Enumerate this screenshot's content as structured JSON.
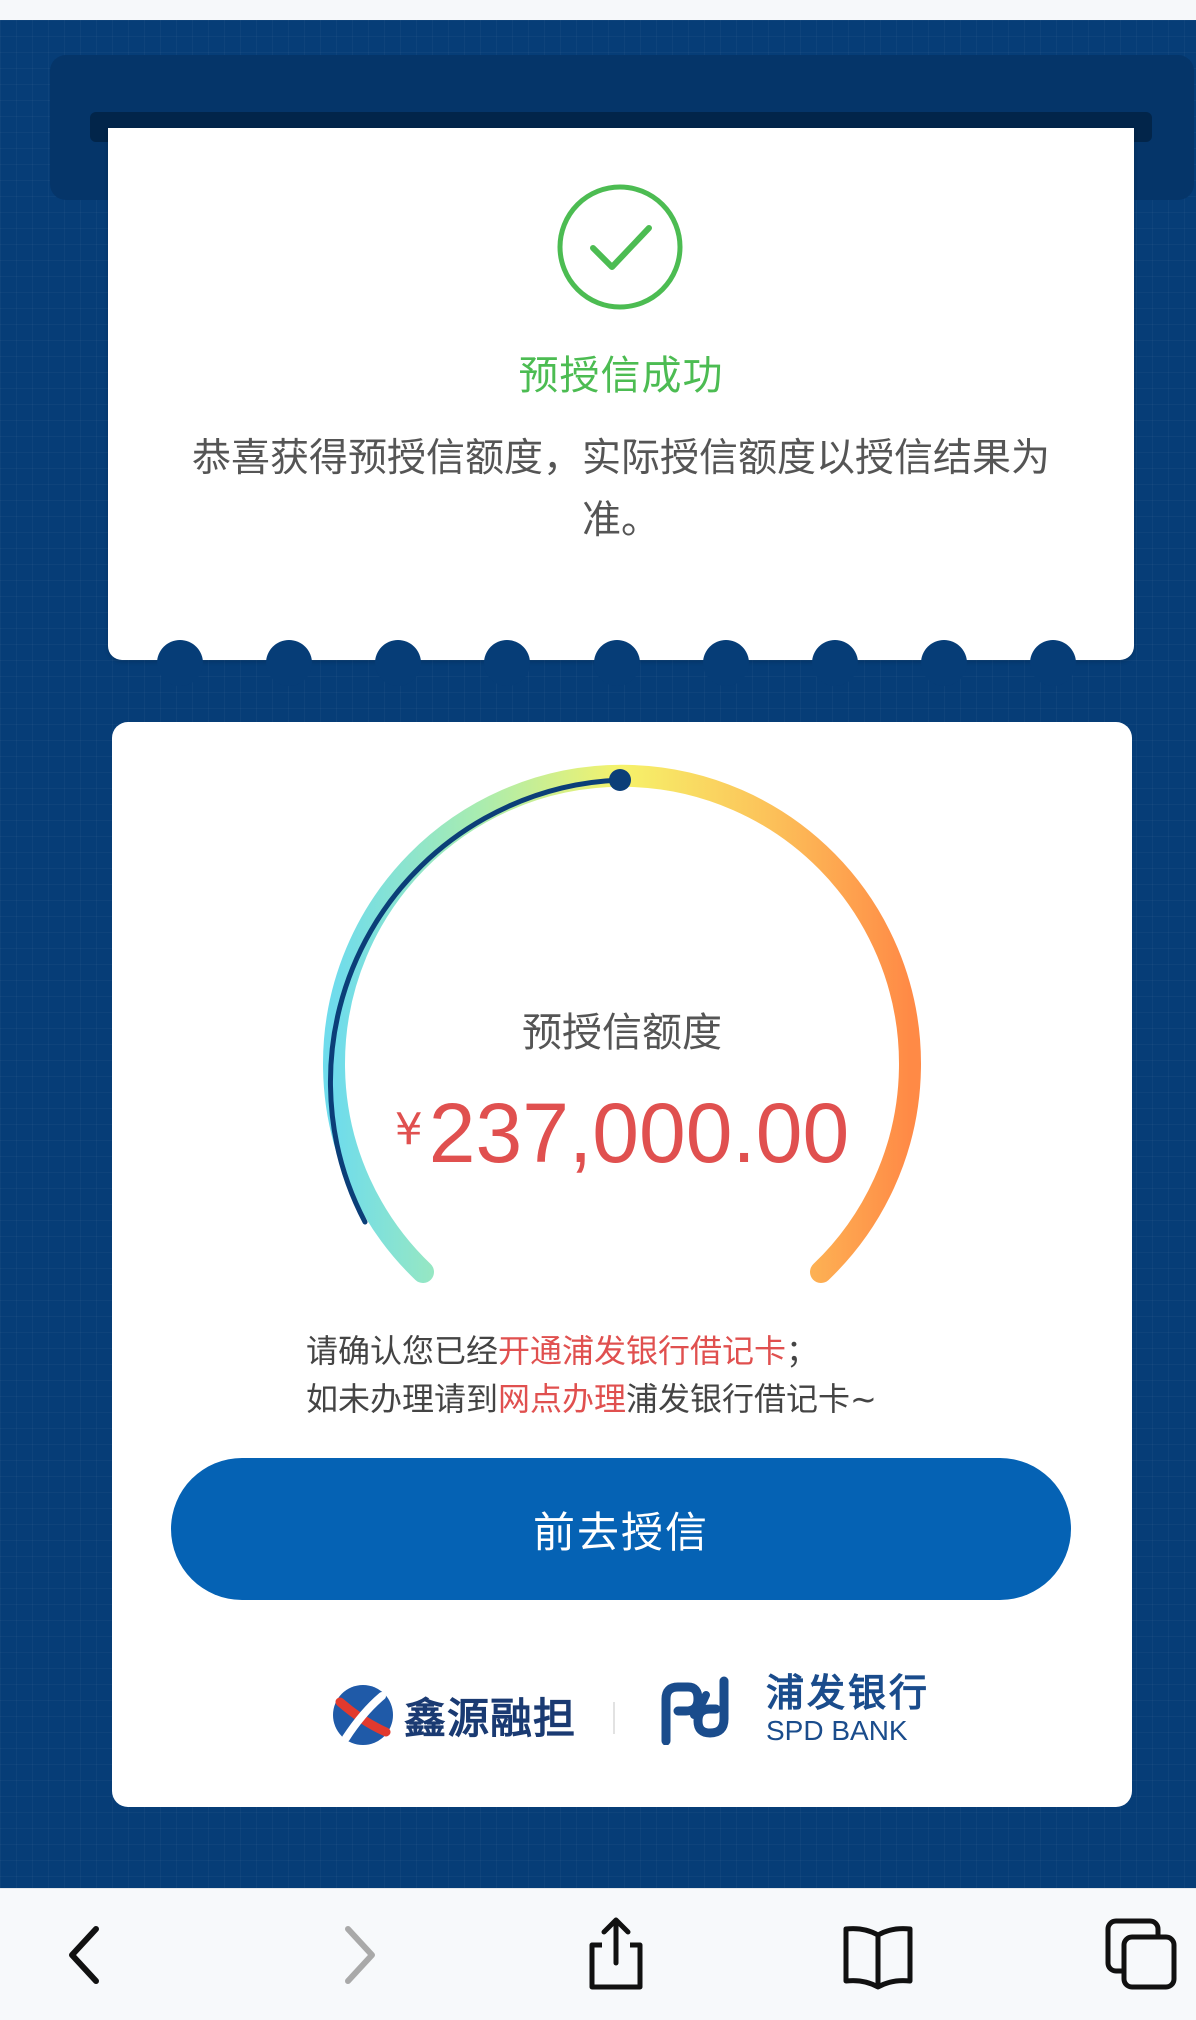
{
  "ticket": {
    "title": "预授信成功",
    "description": "恭喜获得预授信额度，实际授信额度以授信结果为准。"
  },
  "quota": {
    "label": "预授信额度",
    "currency": "¥",
    "amount": "237,000.00"
  },
  "notice": {
    "line1_prefix": "请确认您已经",
    "line1_link": "开通浦发银行借记卡",
    "line1_suffix": "；",
    "line2_prefix": "如未办理请到",
    "line2_link": "网点办理",
    "line2_suffix": "浦发银行借记卡~"
  },
  "button": {
    "label": "前去授信"
  },
  "partners": {
    "guarantor": "鑫源融担",
    "bank_cn": "浦发银行",
    "bank_en": "SPD BANK"
  },
  "toolbar": {
    "icons": [
      "chevron-left-icon",
      "chevron-right-icon",
      "share-icon",
      "bookmarks-icon",
      "tabs-icon"
    ]
  },
  "colors": {
    "background": "#063d77",
    "success": "#4cbc52",
    "accent_red": "#e0504f",
    "button": "#0562b4"
  }
}
